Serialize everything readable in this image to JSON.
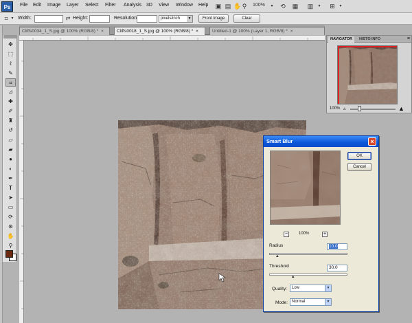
{
  "app": {
    "logo": "Ps",
    "accent": "#2b5ea8"
  },
  "menubar": {
    "items": [
      "File",
      "Edit",
      "Image",
      "Layer",
      "Select",
      "Filter",
      "Analysis",
      "3D",
      "View",
      "Window",
      "Help"
    ],
    "zoom": "100%",
    "icons": [
      "hand-icon",
      "zoom-tool-icon",
      "rotate-view-icon",
      "arrange-documents-icon",
      "screen-mode-icon"
    ]
  },
  "options_bar": {
    "width_label": "Width:",
    "height_label": "Height:",
    "resolution_label": "Resolution:",
    "units_value": "pixels/inch",
    "front_image_label": "Front Image",
    "clear_label": "Clear"
  },
  "tabs": [
    {
      "label": "Cliffs0034_1_S.jpg @ 100% (RGB/8) *",
      "active": false
    },
    {
      "label": "Cliffs0018_1_S.jpg @ 100% (RGB/8) *",
      "active": true
    },
    {
      "label": "Untitled-1 @ 100% (Layer 1, RGB/8) *",
      "active": false
    }
  ],
  "tools": [
    "move-tool-icon",
    "marquee-tool-icon",
    "lasso-tool-icon",
    "quick-select-tool-icon",
    "crop-tool-icon",
    "eyedropper-tool-icon",
    "healing-brush-tool-icon",
    "brush-tool-icon",
    "clone-stamp-tool-icon",
    "history-brush-tool-icon",
    "eraser-tool-icon",
    "gradient-tool-icon",
    "blur-tool-icon",
    "dodge-tool-icon",
    "pen-tool-icon",
    "type-tool-icon",
    "path-select-tool-icon",
    "shape-tool-icon",
    "3d-rotate-tool-icon",
    "3d-orbit-tool-icon",
    "hand-tool-icon",
    "zoom-tool-icon"
  ],
  "colors": {
    "foreground": "#6a2a10",
    "background": "#ffffff"
  },
  "navigator": {
    "tabs": [
      "NAVIGATOR",
      "HISTO",
      "INFO"
    ],
    "zoom": "100%",
    "view_box_color": "#e02020"
  },
  "dialog": {
    "title": "Smart Blur",
    "ok_label": "OK",
    "cancel_label": "Cancel",
    "preview_zoom": "100%",
    "zoom_out": "−",
    "zoom_in": "+",
    "radius_label": "Radius",
    "radius_value": "10.0",
    "threshold_label": "Threshold",
    "threshold_value": "30.0",
    "quality_label": "Quality:",
    "quality_value": "Low",
    "mode_label": "Mode:",
    "mode_value": "Normal",
    "radius_slider_fraction": 0.1,
    "threshold_slider_fraction": 0.3
  }
}
